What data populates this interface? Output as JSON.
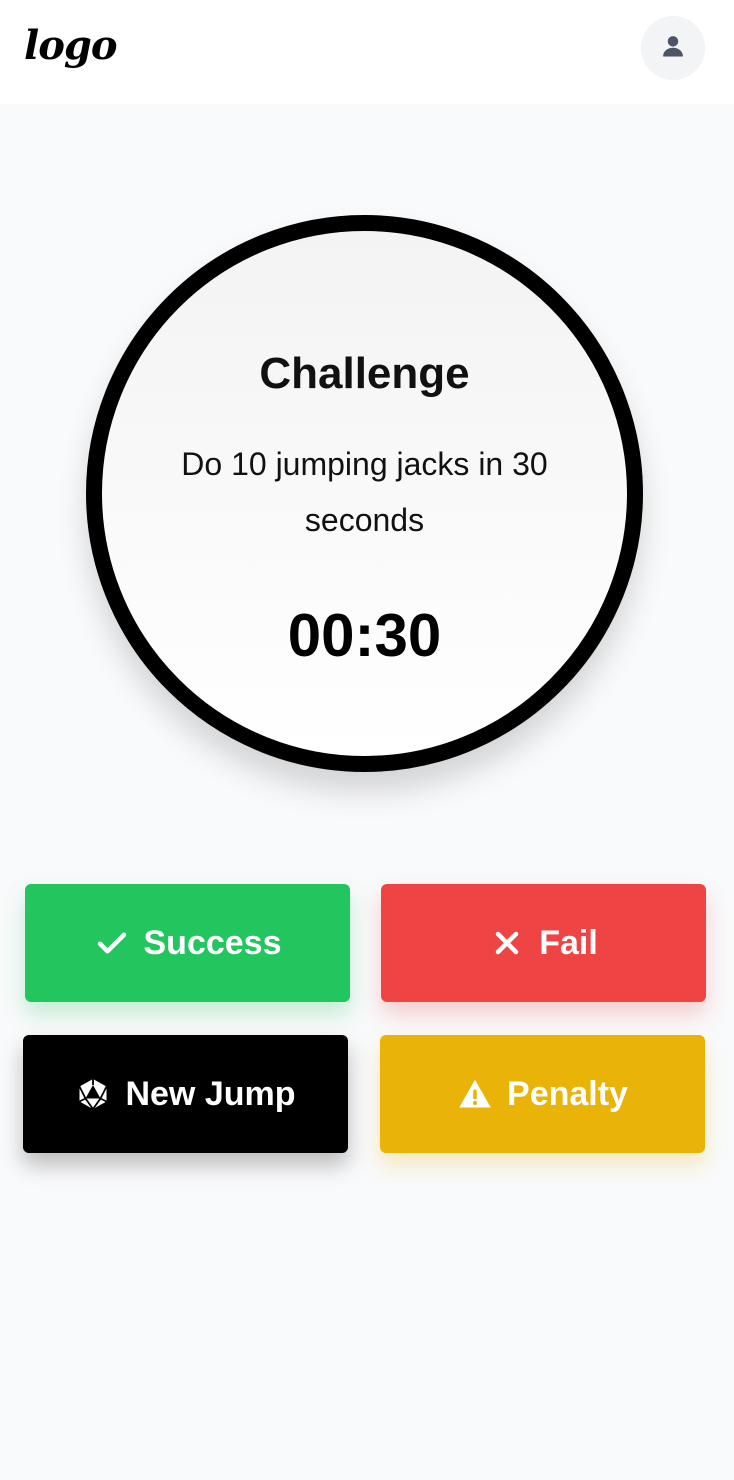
{
  "header": {
    "logo_text": "logo",
    "avatar_icon": "user-icon"
  },
  "challenge": {
    "title": "Challenge",
    "description": "Do 10 jumping jacks in 30 seconds",
    "timer": "00:30"
  },
  "actions": {
    "success_label": "Success",
    "fail_label": "Fail",
    "new_jump_label": "New Jump",
    "penalty_label": "Penalty"
  },
  "colors": {
    "success": "#22c55e",
    "fail": "#ef4444",
    "new_jump": "#000000",
    "penalty": "#eab308",
    "background": "#f9fafb"
  }
}
